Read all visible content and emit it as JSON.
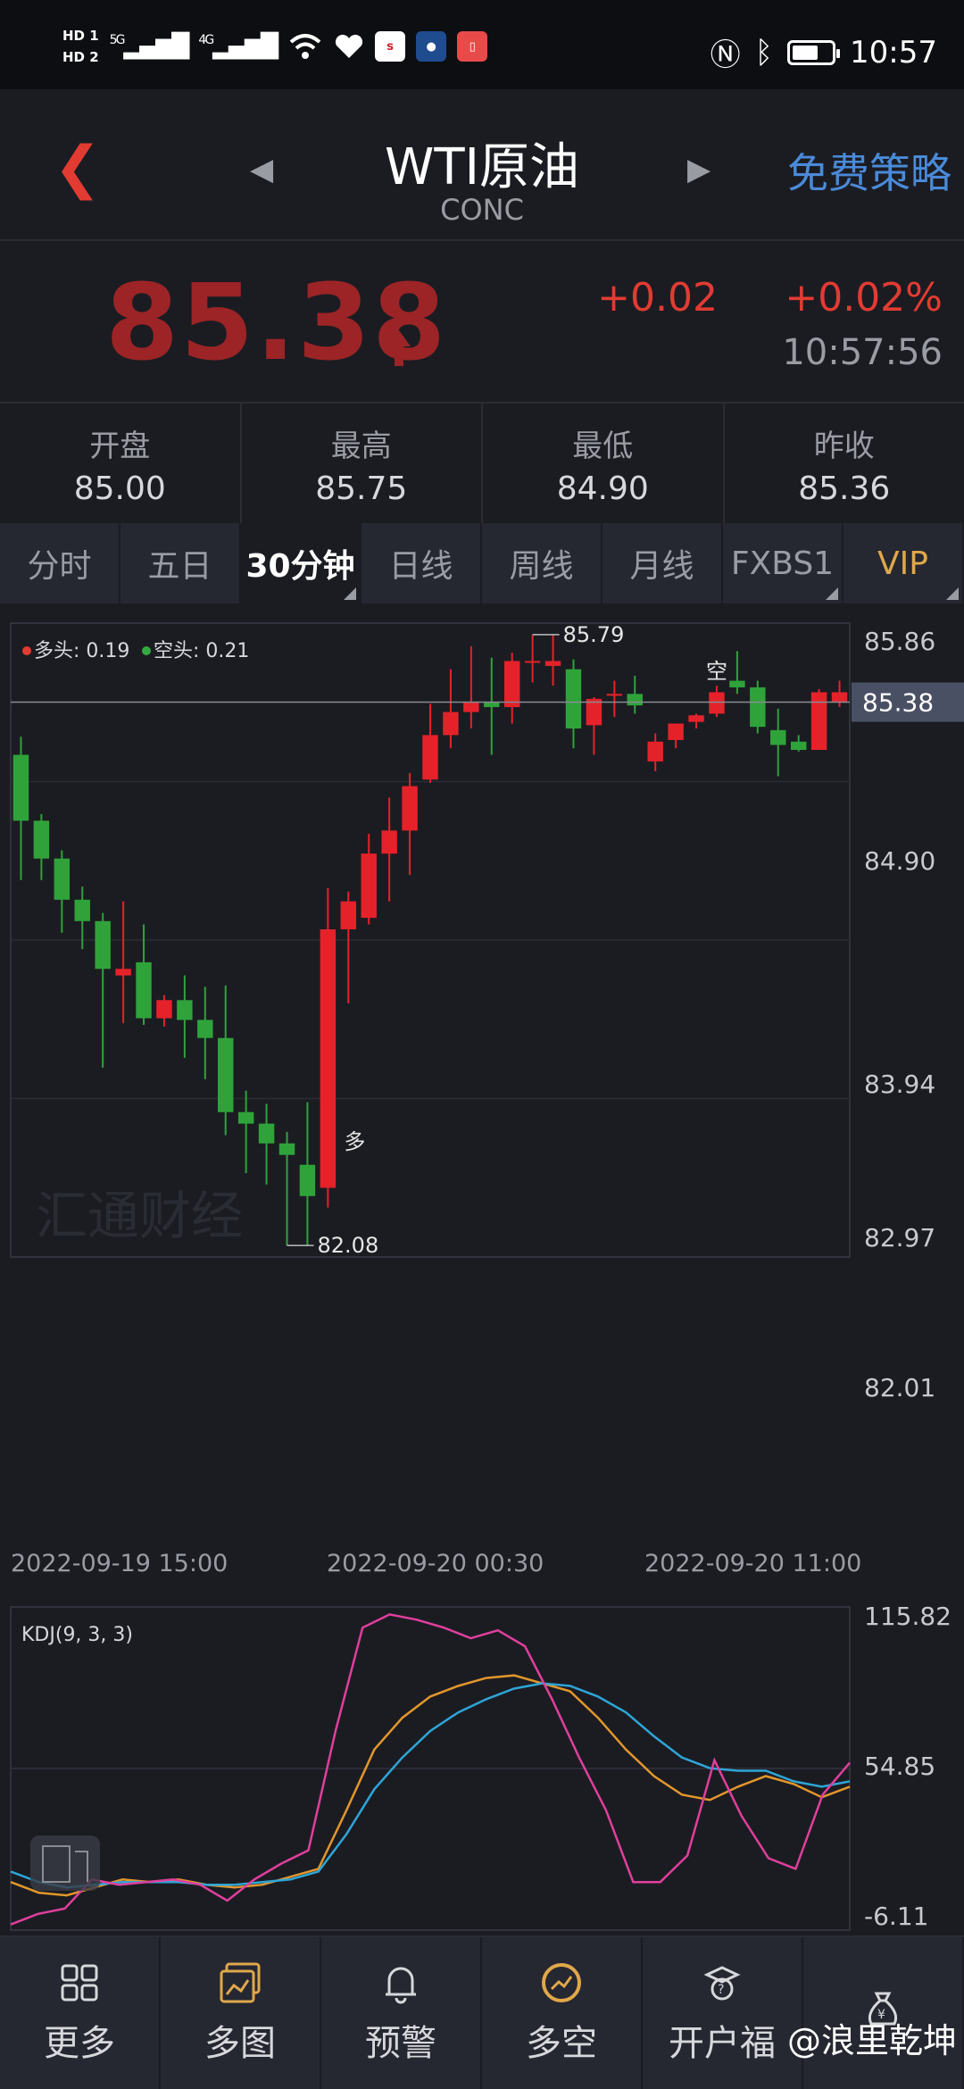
{
  "status_bar": {
    "hd1": "HD 1",
    "hd2": "HD 2",
    "net1": "5G",
    "net2": "4G",
    "time": "10:57"
  },
  "header": {
    "title": "WTI原油",
    "subtitle": "CONC",
    "strategy_button": "免费策略"
  },
  "quote": {
    "price": "85.38",
    "change": "+0.02",
    "change_pct": "+0.02%",
    "time": "10:57:56",
    "price_color": "#9c2426",
    "up_color": "#e23b32"
  },
  "stats": [
    {
      "label": "开盘",
      "value": "85.00"
    },
    {
      "label": "最高",
      "value": "85.75"
    },
    {
      "label": "最低",
      "value": "84.90"
    },
    {
      "label": "昨收",
      "value": "85.36"
    }
  ],
  "tabs": [
    {
      "label": "分时",
      "active": false,
      "corner": false
    },
    {
      "label": "五日",
      "active": false,
      "corner": false
    },
    {
      "label": "30分钟",
      "active": true,
      "corner": true
    },
    {
      "label": "日线",
      "active": false,
      "corner": false
    },
    {
      "label": "周线",
      "active": false,
      "corner": false
    },
    {
      "label": "月线",
      "active": false,
      "corner": false
    },
    {
      "label": "FXBS1",
      "active": false,
      "corner": true
    },
    {
      "label": "VIP",
      "active": false,
      "corner": true
    }
  ],
  "chart_data": [
    {
      "type": "candlestick",
      "legend": [
        {
          "label": "多头: 0.19",
          "color": "#e23b32"
        },
        {
          "label": "空头: 0.21",
          "color": "#35a941"
        }
      ],
      "y_ticks": [
        "85.86",
        "84.90",
        "83.94",
        "82.97",
        "82.01"
      ],
      "ylim": [
        82.01,
        85.86
      ],
      "current_price": "85.38",
      "high_label": "85.79",
      "low_label": "82.08",
      "x_ticks": [
        "2022-09-19 15:00",
        "2022-09-20 00:30",
        "2022-09-20 11:00"
      ],
      "annotations": [
        {
          "text": "多",
          "bar": 15
        },
        {
          "text": "空",
          "bar": 34
        }
      ],
      "watermark": "汇通财经",
      "candles": [
        {
          "o": 85.06,
          "h": 85.17,
          "l": 84.3,
          "c": 84.66
        },
        {
          "o": 84.66,
          "h": 84.7,
          "l": 84.3,
          "c": 84.43
        },
        {
          "o": 84.43,
          "h": 84.48,
          "l": 83.98,
          "c": 84.18
        },
        {
          "o": 84.18,
          "h": 84.26,
          "l": 83.88,
          "c": 84.05
        },
        {
          "o": 84.05,
          "h": 84.1,
          "l": 83.16,
          "c": 83.76
        },
        {
          "o": 83.72,
          "h": 84.17,
          "l": 83.43,
          "c": 83.76
        },
        {
          "o": 83.8,
          "h": 84.03,
          "l": 83.42,
          "c": 83.46
        },
        {
          "o": 83.46,
          "h": 83.6,
          "l": 83.41,
          "c": 83.57
        },
        {
          "o": 83.57,
          "h": 83.72,
          "l": 83.22,
          "c": 83.45
        },
        {
          "o": 83.45,
          "h": 83.65,
          "l": 83.09,
          "c": 83.34
        },
        {
          "o": 83.34,
          "h": 83.66,
          "l": 82.75,
          "c": 82.89
        },
        {
          "o": 82.89,
          "h": 83.02,
          "l": 82.52,
          "c": 82.82
        },
        {
          "o": 82.82,
          "h": 82.94,
          "l": 82.45,
          "c": 82.7
        },
        {
          "o": 82.7,
          "h": 82.77,
          "l": 82.08,
          "c": 82.63
        },
        {
          "o": 82.57,
          "h": 82.95,
          "l": 82.08,
          "c": 82.38
        },
        {
          "o": 82.43,
          "h": 84.25,
          "l": 82.31,
          "c": 84.0
        },
        {
          "o": 84.0,
          "h": 84.23,
          "l": 83.55,
          "c": 84.17
        },
        {
          "o": 84.07,
          "h": 84.58,
          "l": 84.03,
          "c": 84.46
        },
        {
          "o": 84.46,
          "h": 84.8,
          "l": 84.17,
          "c": 84.6
        },
        {
          "o": 84.6,
          "h": 84.95,
          "l": 84.33,
          "c": 84.87
        },
        {
          "o": 84.91,
          "h": 85.37,
          "l": 84.89,
          "c": 85.18
        },
        {
          "o": 85.18,
          "h": 85.58,
          "l": 85.1,
          "c": 85.32
        },
        {
          "o": 85.32,
          "h": 85.72,
          "l": 85.22,
          "c": 85.38
        },
        {
          "o": 85.38,
          "h": 85.65,
          "l": 85.06,
          "c": 85.35
        },
        {
          "o": 85.35,
          "h": 85.68,
          "l": 85.25,
          "c": 85.63
        },
        {
          "o": 85.63,
          "h": 85.79,
          "l": 85.5,
          "c": 85.63
        },
        {
          "o": 85.6,
          "h": 85.79,
          "l": 85.48,
          "c": 85.63
        },
        {
          "o": 85.58,
          "h": 85.64,
          "l": 85.1,
          "c": 85.22
        },
        {
          "o": 85.24,
          "h": 85.41,
          "l": 85.06,
          "c": 85.4
        },
        {
          "o": 85.42,
          "h": 85.51,
          "l": 85.29,
          "c": 85.43
        },
        {
          "o": 85.43,
          "h": 85.54,
          "l": 85.31,
          "c": 85.36
        },
        {
          "o": 85.02,
          "h": 85.19,
          "l": 84.96,
          "c": 85.14
        },
        {
          "o": 85.15,
          "h": 85.25,
          "l": 85.1,
          "c": 85.25
        },
        {
          "o": 85.26,
          "h": 85.31,
          "l": 85.22,
          "c": 85.3
        },
        {
          "o": 85.31,
          "h": 85.48,
          "l": 85.29,
          "c": 85.44
        },
        {
          "o": 85.51,
          "h": 85.69,
          "l": 85.43,
          "c": 85.47
        },
        {
          "o": 85.47,
          "h": 85.51,
          "l": 85.19,
          "c": 85.23
        },
        {
          "o": 85.21,
          "h": 85.34,
          "l": 84.93,
          "c": 85.12
        },
        {
          "o": 85.14,
          "h": 85.18,
          "l": 85.08,
          "c": 85.09
        },
        {
          "o": 85.09,
          "h": 85.46,
          "l": 85.09,
          "c": 85.44
        },
        {
          "o": 85.38,
          "h": 85.51,
          "l": 85.35,
          "c": 85.44
        }
      ]
    },
    {
      "type": "line",
      "label": "KDJ(9, 3, 3)",
      "y_ticks": [
        "115.82",
        "54.85",
        "-6.11"
      ],
      "ylim": [
        -6.11,
        115.82
      ],
      "series": [
        {
          "color": "#e2962b",
          "values": [
            12,
            8,
            7,
            10,
            13,
            12,
            13,
            11,
            10,
            11,
            14,
            17,
            39,
            62,
            74,
            82,
            86,
            89,
            90,
            87,
            84,
            74,
            62,
            52,
            45,
            43,
            48,
            52,
            49,
            44,
            48
          ]
        },
        {
          "color": "#2ea5d7",
          "values": [
            16,
            12,
            10,
            11,
            12,
            12,
            12,
            11,
            11,
            12,
            13,
            16,
            30,
            47,
            59,
            69,
            76,
            81,
            85,
            87,
            86,
            82,
            76,
            67,
            59,
            55,
            54,
            54,
            50,
            48,
            50
          ]
        },
        {
          "color": "#e03f9d",
          "values": [
            -4,
            0,
            2,
            13,
            11,
            12,
            13,
            11,
            5,
            13,
            19,
            24,
            69,
            108,
            113,
            111,
            108,
            104,
            107,
            101,
            81,
            59,
            39,
            12,
            12,
            22,
            58,
            37,
            21,
            17,
            45,
            57
          ]
        }
      ]
    }
  ],
  "bottom_nav": [
    {
      "label": "更多",
      "icon": "grid-icon"
    },
    {
      "label": "多图",
      "icon": "multi-chart-icon"
    },
    {
      "label": "预警",
      "icon": "bell-icon"
    },
    {
      "label": "多空",
      "icon": "bull-bear-icon"
    },
    {
      "label": "开户福",
      "icon": "gift-icon"
    },
    {
      "label": "",
      "icon": "moneybag-icon"
    }
  ],
  "watermark": "@浪里乾坤"
}
